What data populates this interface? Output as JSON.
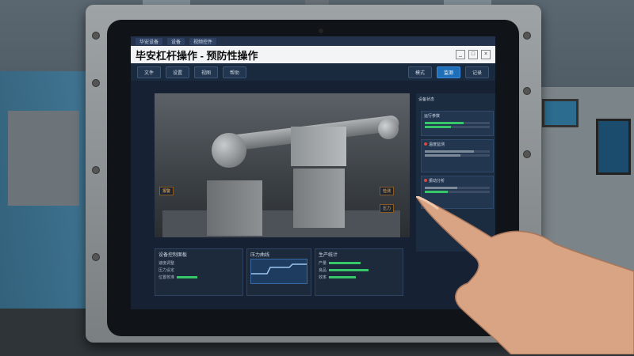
{
  "window": {
    "tabs": [
      "华安设备",
      "设备",
      "视频控件"
    ],
    "title": "毕安杠杆操作 - 预防性操作",
    "controls": [
      "_",
      "□",
      "×"
    ]
  },
  "toolbar": {
    "buttons": [
      "文件",
      "设置",
      "视图",
      "帮助"
    ],
    "right_labels": [
      "模式",
      "监测",
      "记录"
    ]
  },
  "viewer": {
    "labels": [
      "报警",
      "检测",
      "压力"
    ]
  },
  "right_panel": {
    "header": "设备状态",
    "cards": [
      {
        "title": "运行参数",
        "fill": 0.6
      },
      {
        "title": "温度监测",
        "fill": 0.75
      },
      {
        "title": "振动分析",
        "fill": 0.5
      }
    ]
  },
  "bottom": {
    "left_title": "设备控制面板",
    "left_rows": [
      "速度调整",
      "压力设定",
      "位置校准"
    ],
    "mid_title": "压力曲线",
    "right_title": "生产统计",
    "right_rows": [
      "产量",
      "良品",
      "效率"
    ]
  },
  "colors": {
    "accent": "#1f6fb8",
    "ok": "#38c66a",
    "alarm": "#e0473c",
    "warning": "#ffb25a"
  }
}
